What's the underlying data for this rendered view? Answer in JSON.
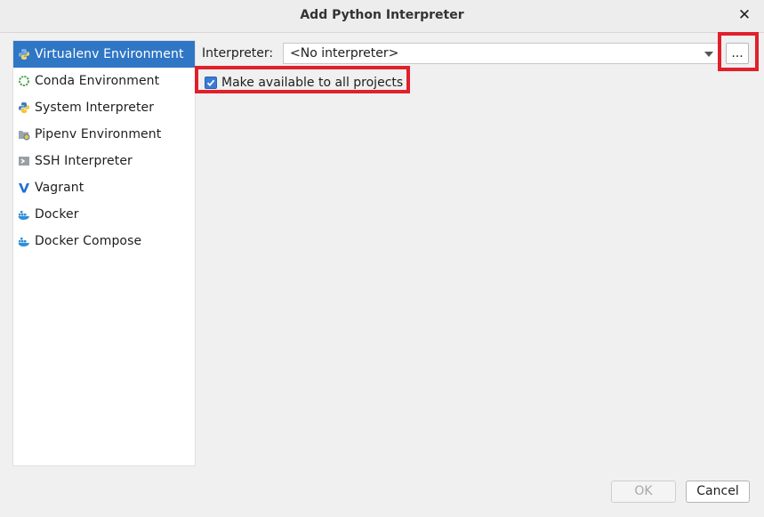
{
  "window": {
    "title": "Add Python Interpreter",
    "close_glyph": "✕"
  },
  "sidebar": {
    "items": [
      {
        "label": "Virtualenv Environment",
        "icon": "python-virtualenv-icon",
        "selected": true
      },
      {
        "label": "Conda Environment",
        "icon": "conda-icon",
        "selected": false
      },
      {
        "label": "System Interpreter",
        "icon": "python-icon",
        "selected": false
      },
      {
        "label": "Pipenv Environment",
        "icon": "pipenv-icon",
        "selected": false
      },
      {
        "label": "SSH Interpreter",
        "icon": "ssh-terminal-icon",
        "selected": false
      },
      {
        "label": "Vagrant",
        "icon": "vagrant-icon",
        "selected": false
      },
      {
        "label": "Docker",
        "icon": "docker-icon",
        "selected": false
      },
      {
        "label": "Docker Compose",
        "icon": "docker-compose-icon",
        "selected": false
      }
    ]
  },
  "form": {
    "interpreter_label": "Interpreter:",
    "interpreter_value": "<No interpreter>",
    "browse_label": "...",
    "make_available_label": "Make available to all projects",
    "make_available_checked": true
  },
  "footer": {
    "ok_label": "OK",
    "ok_enabled": false,
    "cancel_label": "Cancel"
  },
  "colors": {
    "selection": "#2f76c5",
    "highlight": "#e0202b",
    "checkbox": "#3a7bd5"
  }
}
